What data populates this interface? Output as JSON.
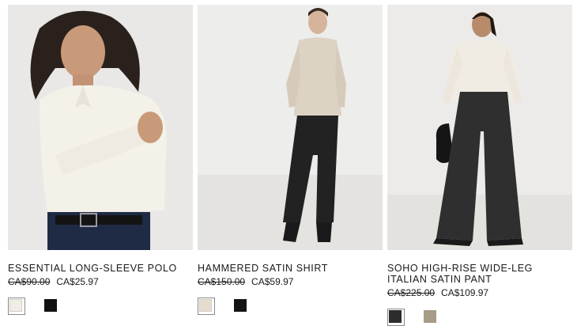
{
  "products": [
    {
      "name": "ESSENTIAL LONG-SLEEVE POLO",
      "was_price": "CA$90.00",
      "sale_price": "CA$25.97",
      "swatches": [
        {
          "color": "#f1ede4",
          "selected": true
        },
        {
          "color": "#111111",
          "selected": false
        }
      ]
    },
    {
      "name": "HAMMERED SATIN SHIRT",
      "was_price": "CA$150.00",
      "sale_price": "CA$59.97",
      "swatches": [
        {
          "color": "#e6dccd",
          "selected": true
        },
        {
          "color": "#141414",
          "selected": false
        }
      ]
    },
    {
      "name_line1": "SOHO HIGH-RISE WIDE-LEG",
      "name_line2": "ITALIAN SATIN PANT",
      "was_price": "CA$225.00",
      "sale_price": "CA$109.97",
      "swatches": [
        {
          "color": "#2c2c2c",
          "selected": true
        },
        {
          "color": "#a79c87",
          "selected": false
        }
      ]
    }
  ]
}
